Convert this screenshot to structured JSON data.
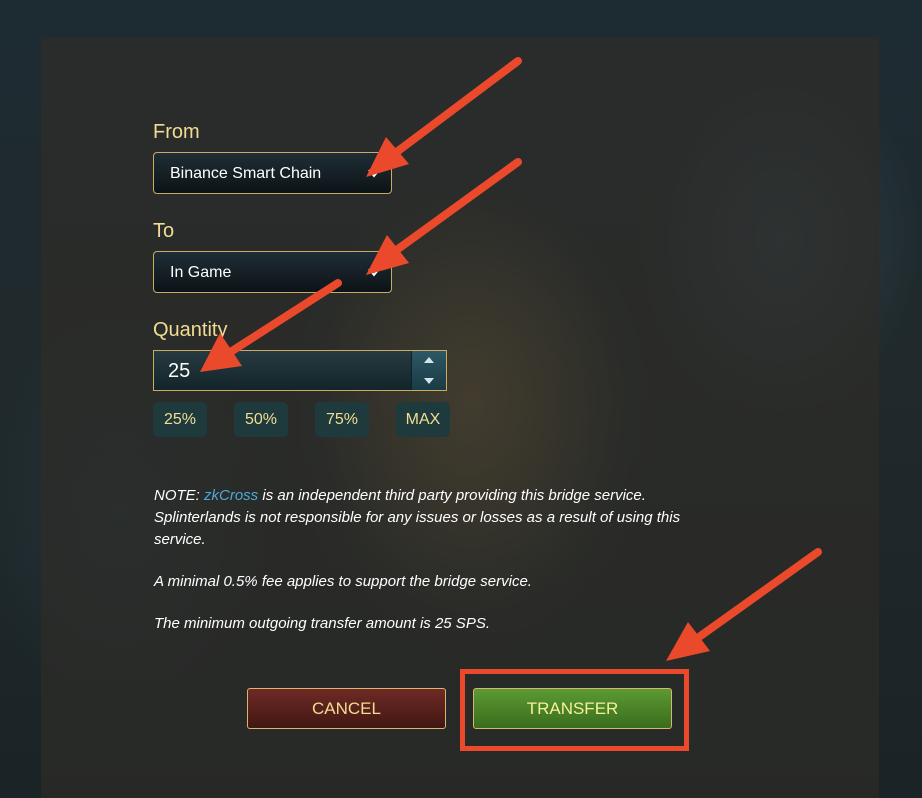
{
  "form": {
    "from": {
      "label": "From",
      "value": "Binance Smart Chain"
    },
    "to": {
      "label": "To",
      "value": "In Game"
    },
    "quantity": {
      "label": "Quantity",
      "value": "25"
    },
    "percent_buttons": [
      "25%",
      "50%",
      "75%",
      "MAX"
    ]
  },
  "notes": {
    "line1_prefix": "NOTE: ",
    "line1_link": "zkCross",
    "line1_suffix": " is an independent third party providing this bridge service.",
    "line1_cont": "Splinterlands is not responsible for any issues or losses as a result of using this",
    "line1_cont2": "service.",
    "fee": "A minimal 0.5% fee applies to support the bridge service.",
    "minimum": "The minimum outgoing transfer amount is 25 SPS."
  },
  "actions": {
    "cancel": "CANCEL",
    "transfer": "TRANSFER"
  },
  "colors": {
    "label_gold": "#f3dc92",
    "annotation_red": "#ea4a2b",
    "link_blue": "#4ea8d8",
    "transfer_green": "#4f8a2b",
    "cancel_red": "#5e231d"
  },
  "icons": {
    "select_chevron": "chevron-down-icon",
    "stepper_up": "caret-up-icon",
    "stepper_down": "caret-down-icon",
    "annotation": "arrow-annotation"
  }
}
